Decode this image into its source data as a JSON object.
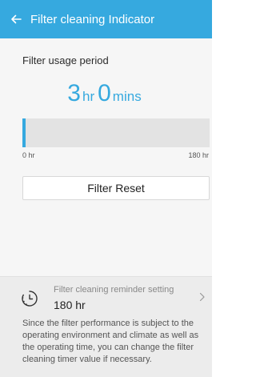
{
  "header": {
    "title": "Filter cleaning Indicator",
    "back_icon": "arrow-left-icon",
    "background": "#36a9df"
  },
  "usage": {
    "section_title": "Filter usage period",
    "hours": "3",
    "hours_unit": "hr",
    "minutes": "0",
    "minutes_unit": "mins",
    "accent_color": "#36a9df",
    "progress_fraction": 0.0167,
    "scale_min": "0 hr",
    "scale_max": "180 hr"
  },
  "reset_button": {
    "label": "Filter Reset"
  },
  "reminder": {
    "icon": "timer-icon",
    "label": "Filter cleaning reminder setting",
    "value": "180 hr",
    "chevron_icon": "chevron-right-icon"
  },
  "description": "Since the filter performance is subject to the operating environment and climate as well as the operating time, you can change the filter cleaning timer value if necessary."
}
